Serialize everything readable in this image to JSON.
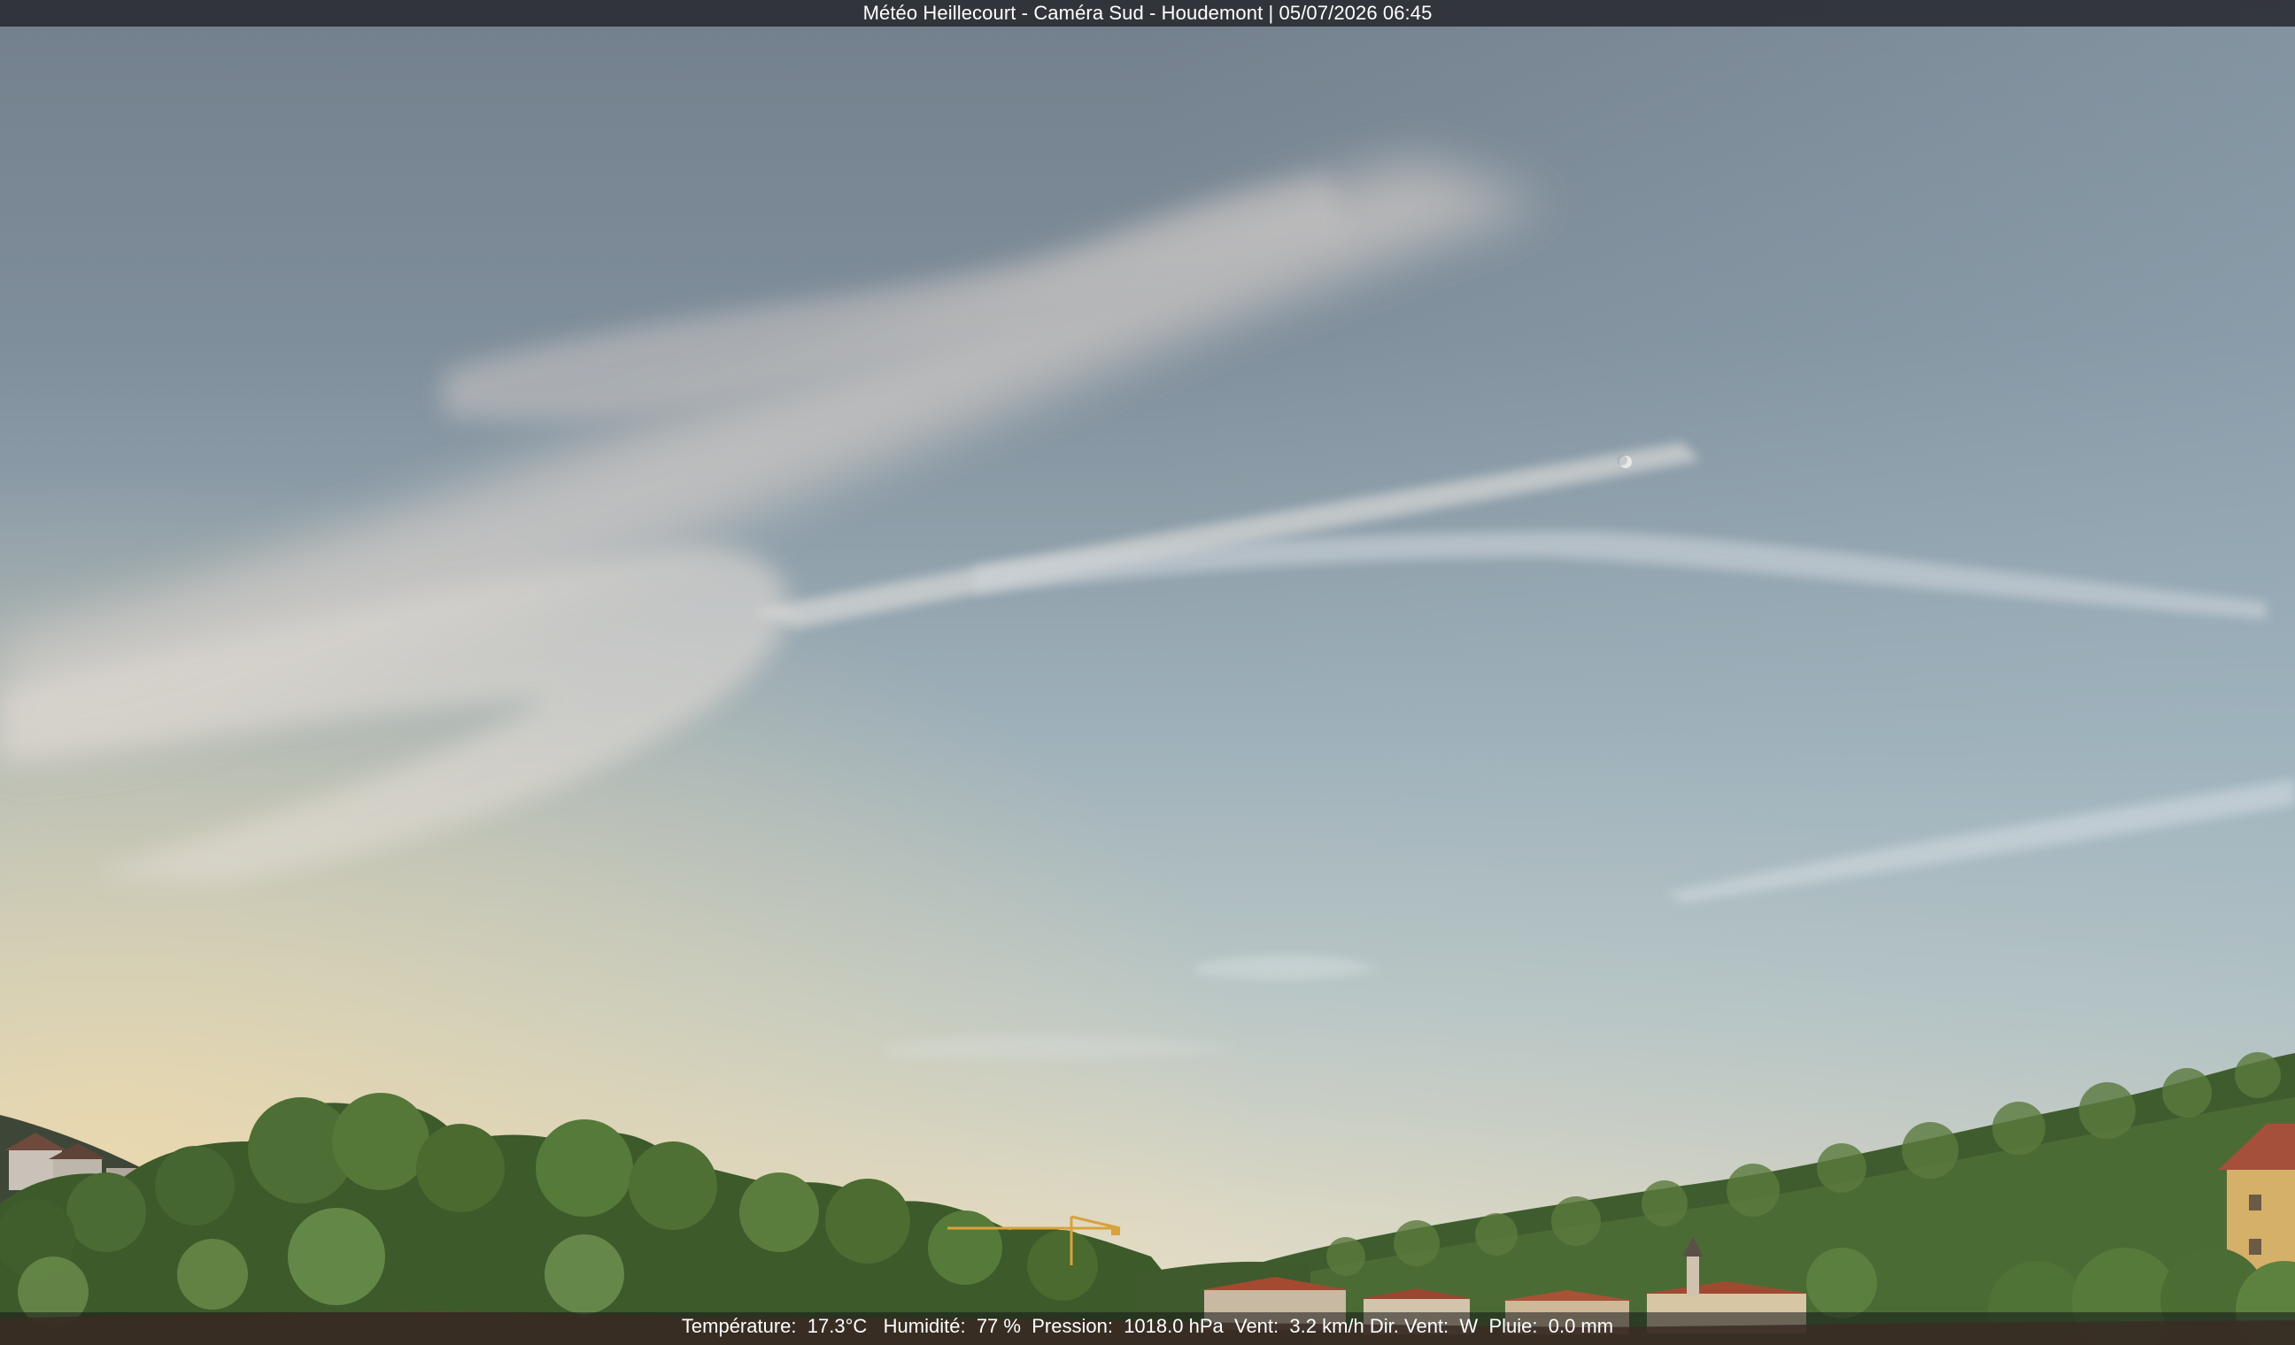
{
  "camera": {
    "title": "Météo Heillecourt - Caméra Sud - Houdemont | 05/07/2026 06:45"
  },
  "weather": {
    "temperature_label": "Température:",
    "temperature_value": "17.3°C",
    "humidity_label": "Humidité:",
    "humidity_value": "77 %",
    "pressure_label": "Pression:",
    "pressure_value": "1018.0 hPa",
    "wind_label": "Vent:",
    "wind_value": "3.2 km/h",
    "wind_dir_label": "Dir. Vent:",
    "wind_dir_value": "W",
    "rain_label": "Pluie:",
    "rain_value": "0.0 mm"
  },
  "scene": {
    "sky_top_color": "#7d8894",
    "sky_mid_color": "#a6b8c0",
    "horizon_color": "#e6dcc2",
    "forest_color": "#4a6a32",
    "roof_color": "#9a4a32",
    "moon_icon": "moon-icon",
    "crane_icon": "crane-icon"
  }
}
